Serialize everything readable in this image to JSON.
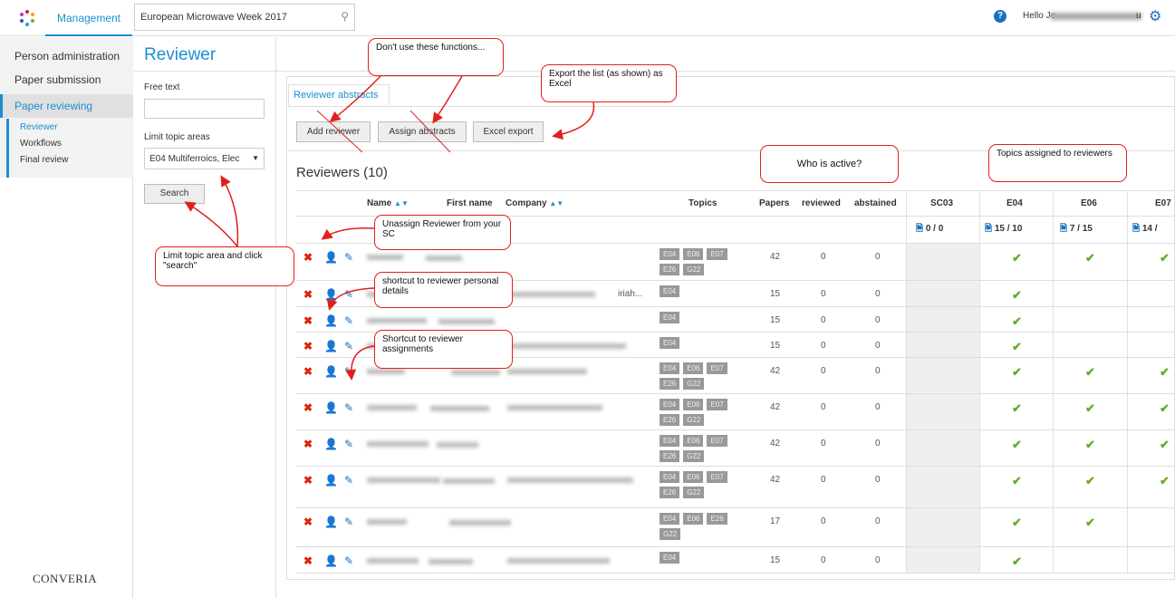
{
  "app": {
    "tab": "Management",
    "event": "European Microwave Week 2017",
    "hello": "Hello Je",
    "hello_suffix": "u",
    "brand": "CONVERIA"
  },
  "sidebar": {
    "items": [
      {
        "label": "Person administration"
      },
      {
        "label": "Paper submission"
      },
      {
        "label": "Paper reviewing"
      }
    ],
    "subitems": [
      {
        "label": "Reviewer"
      },
      {
        "label": "Workflows"
      },
      {
        "label": "Final review"
      }
    ]
  },
  "page": {
    "title": "Reviewer",
    "free_text_label": "Free text",
    "topic_label": "Limit topic areas",
    "topic_value": "E04 Multiferroics, Elec",
    "search_label": "Search",
    "tab_label": "Reviewer abstracts",
    "buttons": {
      "add": "Add reviewer",
      "assign": "Assign abstracts",
      "excel": "Excel export"
    },
    "list_title": "Reviewers (10)"
  },
  "table": {
    "headers": {
      "name": "Name",
      "first_name": "First name",
      "company": "Company",
      "topics": "Topics",
      "papers": "Papers",
      "reviewed": "reviewed",
      "abstained": "abstained",
      "sc03": "SC03",
      "e04": "E04",
      "e06": "E06",
      "e07": "E07"
    },
    "stats": {
      "sc03": "0 / 0",
      "e04": "15 / 10",
      "e06": "7 / 15",
      "e07": "14 /"
    },
    "rows": [
      {
        "tags": [
          "E04",
          "E06",
          "E07",
          "E26",
          "G22"
        ],
        "papers": "42",
        "reviewed": "0",
        "abstained": "0",
        "company": "",
        "checks": [
          1,
          1,
          1
        ]
      },
      {
        "tags": [
          "E04"
        ],
        "papers": "15",
        "reviewed": "0",
        "abstained": "0",
        "company": "iriah...",
        "checks": [
          1,
          0,
          0
        ]
      },
      {
        "tags": [
          "E04"
        ],
        "papers": "15",
        "reviewed": "0",
        "abstained": "0",
        "company": "",
        "checks": [
          1,
          0,
          0
        ]
      },
      {
        "tags": [
          "E04"
        ],
        "papers": "15",
        "reviewed": "0",
        "abstained": "0",
        "company": "",
        "checks": [
          1,
          0,
          0
        ]
      },
      {
        "tags": [
          "E04",
          "E06",
          "E07",
          "E26",
          "G22"
        ],
        "papers": "42",
        "reviewed": "0",
        "abstained": "0",
        "company": "",
        "checks": [
          1,
          1,
          1
        ]
      },
      {
        "tags": [
          "E04",
          "E06",
          "E07",
          "E26",
          "G22"
        ],
        "papers": "42",
        "reviewed": "0",
        "abstained": "0",
        "company": "",
        "checks": [
          1,
          1,
          1
        ]
      },
      {
        "tags": [
          "E04",
          "E06",
          "E07",
          "E26",
          "G22"
        ],
        "papers": "42",
        "reviewed": "0",
        "abstained": "0",
        "company": "",
        "checks": [
          1,
          1,
          1
        ]
      },
      {
        "tags": [
          "E04",
          "E06",
          "E07",
          "E26",
          "G22"
        ],
        "papers": "42",
        "reviewed": "0",
        "abstained": "0",
        "company": "",
        "checks": [
          1,
          1,
          1
        ]
      },
      {
        "tags": [
          "E04",
          "E06",
          "E26",
          "G22"
        ],
        "papers": "17",
        "reviewed": "0",
        "abstained": "0",
        "company": "",
        "checks": [
          1,
          1,
          0
        ]
      },
      {
        "tags": [
          "E04"
        ],
        "papers": "15",
        "reviewed": "0",
        "abstained": "0",
        "company": "",
        "checks": [
          1,
          0,
          0
        ]
      }
    ]
  },
  "callouts": {
    "dont_use": "Don't use these functions...",
    "export": "Export the list (as shown) as Excel",
    "active": "Who is active?",
    "topics": "Topics assigned to reviewers",
    "unassign": "Unassign Reviewer from your SC",
    "details": "shortcut to reviewer personal details",
    "assignments": "Shortcut to reviewer assignments",
    "limit": "Limit topic area and click \"search\""
  },
  "colors": {
    "accent": "#1a8fd0",
    "delete": "#e0230a",
    "check": "#6aaa2a",
    "callout": "#e0201a"
  }
}
